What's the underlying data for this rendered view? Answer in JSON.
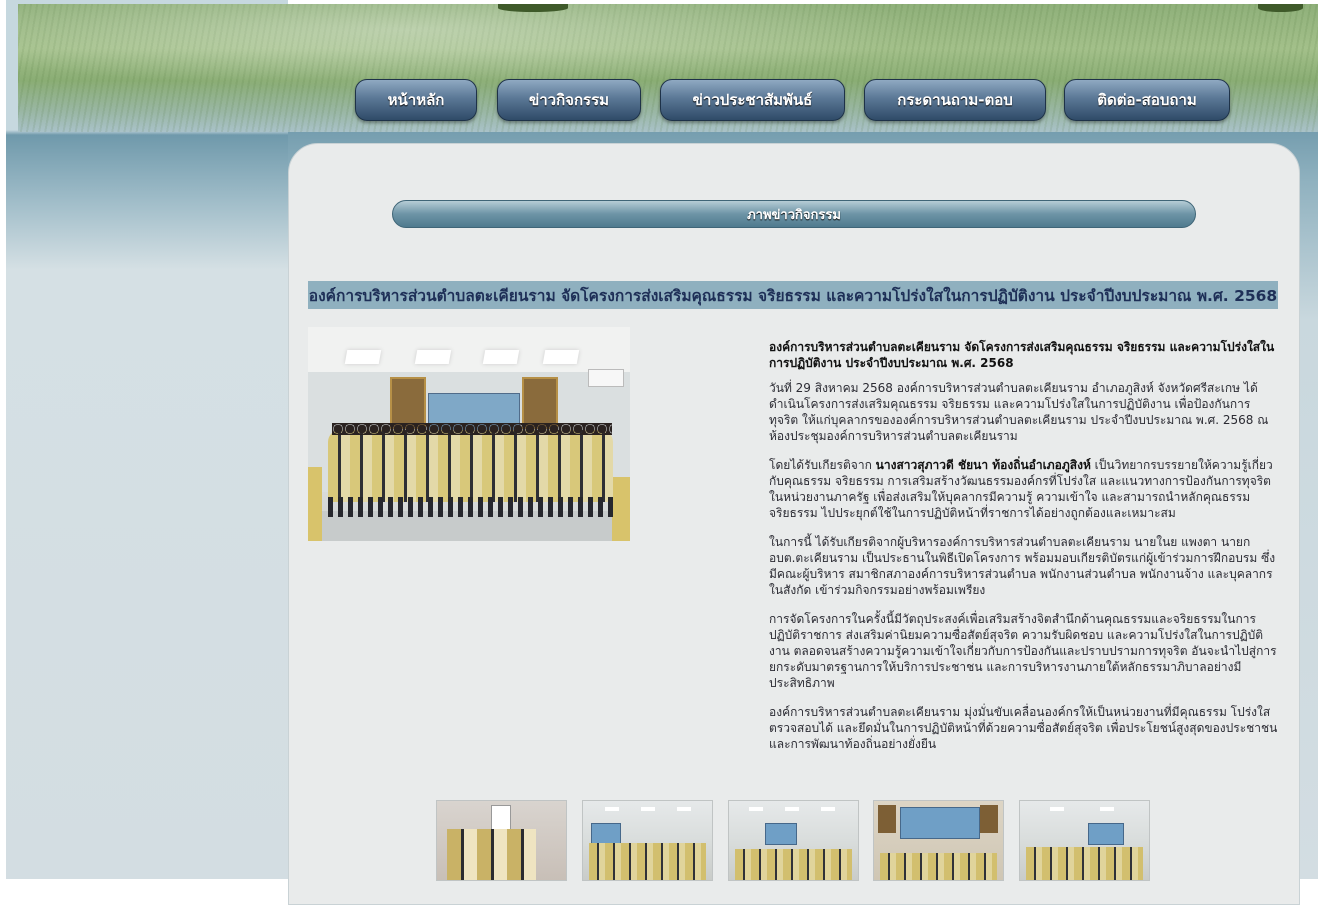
{
  "nav": {
    "items": [
      {
        "label": "หน้าหลัก"
      },
      {
        "label": "ข่าวกิจกรรม"
      },
      {
        "label": "ข่าวประชาสัมพันธ์"
      },
      {
        "label": "กระดานถาม-ตอบ"
      },
      {
        "label": "ติดต่อ-สอบถาม"
      }
    ]
  },
  "section": {
    "title": "ภาพข่าวกิจกรรม"
  },
  "article": {
    "title": "องค์การบริหารส่วนตำบลตะเคียนราม จัดโครงการส่งเสริมคุณธรรม จริยธรรม และความโปร่งใสในการปฏิบัติงาน ประจำปีงบประมาณ พ.ศ. 2568",
    "lead": "องค์การบริหารส่วนตำบลตะเคียนราม จัดโครงการส่งเสริมคุณธรรม จริยธรรม และความโปร่งใสในการปฏิบัติงาน ประจำปีงบประมาณ พ.ศ. 2568",
    "p1": "วันที่ 29 สิงหาคม 2568 องค์การบริหารส่วนตำบลตะเคียนราม อำเภอภูสิงห์ จังหวัดศรีสะเกษ ได้ดำเนินโครงการส่งเสริมคุณธรรม จริยธรรม และความโปร่งใสในการปฏิบัติงาน เพื่อป้องกันการทุจริต ให้แก่บุคลากรขององค์การบริหารส่วนตำบลตะเคียนราม ประจำปีงบประมาณ พ.ศ. 2568 ณ ห้องประชุมองค์การบริหารส่วนตำบลตะเคียนราม",
    "p2_before": "โดยได้รับเกียรติจาก ",
    "p2_bold": "นางสาวสุภาวดี ชัยนา ท้องถิ่นอำเภอภูสิงห์",
    "p2_after": " เป็นวิทยากรบรรยายให้ความรู้เกี่ยวกับคุณธรรม จริยธรรม การเสริมสร้างวัฒนธรรมองค์กรที่โปร่งใส และแนวทางการป้องกันการทุจริตในหน่วยงานภาครัฐ เพื่อส่งเสริมให้บุคลากรมีความรู้ ความเข้าใจ และสามารถนำหลักคุณธรรม จริยธรรม ไปประยุกต์ใช้ในการปฏิบัติหน้าที่ราชการได้อย่างถูกต้องและเหมาะสม",
    "p3": "ในการนี้ ได้รับเกียรติจากผู้บริหารองค์การบริหารส่วนตำบลตะเคียนราม นายในย แพงตา นายก อบต.ตะเคียนราม เป็นประธานในพิธีเปิดโครงการ พร้อมมอบเกียรติบัตรแก่ผู้เข้าร่วมการฝึกอบรม ซึ่งมีคณะผู้บริหาร สมาชิกสภาองค์การบริหารส่วนตำบล พนักงานส่วนตำบล พนักงานจ้าง และบุคลากรในสังกัด เข้าร่วมกิจกรรมอย่างพร้อมเพรียง",
    "p4": "การจัดโครงการในครั้งนี้มีวัตถุประสงค์เพื่อเสริมสร้างจิตสำนึกด้านคุณธรรมและจริยธรรมในการปฏิบัติราชการ ส่งเสริมค่านิยมความซื่อสัตย์สุจริต ความรับผิดชอบ และความโปร่งใสในการปฏิบัติงาน ตลอดจนสร้างความรู้ความเข้าใจเกี่ยวกับการป้องกันและปราบปรามการทุจริต อันจะนำไปสู่การยกระดับมาตรฐานการให้บริการประชาชน และการบริหารงานภายใต้หลักธรรมาภิบาลอย่างมีประสิทธิภาพ",
    "p5": "องค์การบริหารส่วนตำบลตะเคียนราม มุ่งมั่นขับเคลื่อนองค์กรให้เป็นหน่วยงานที่มีคุณธรรม โปร่งใส ตรวจสอบได้ และยึดมั่นในการปฏิบัติหน้าที่ด้วยความซื่อสัตย์สุจริต เพื่อประโยชน์สูงสุดของประชาชนและการพัฒนาท้องถิ่นอย่างยั่งยืน"
  },
  "colors": {
    "nav_button": "#4a6888",
    "title_bar": "#8fb0bf",
    "panel": "#e9ebeb",
    "title_text": "#1e2f57"
  }
}
